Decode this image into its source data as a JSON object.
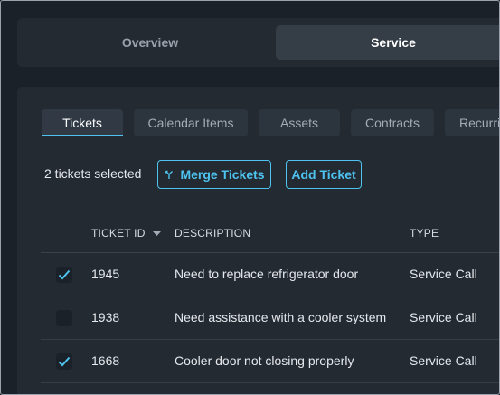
{
  "top_tabs": [
    {
      "label": "Overview",
      "active": false
    },
    {
      "label": "Service",
      "active": true
    }
  ],
  "sub_tabs": [
    {
      "label": "Tickets",
      "active": true
    },
    {
      "label": "Calendar Items",
      "active": false
    },
    {
      "label": "Assets",
      "active": false
    },
    {
      "label": "Contracts",
      "active": false
    },
    {
      "label": "Recurri",
      "active": false
    }
  ],
  "toolbar": {
    "selection_text": "2 tickets selected",
    "merge_label": "Merge Tickets",
    "merge_icon": "merge-icon",
    "add_label": "Add Ticket"
  },
  "table": {
    "columns": [
      "TICKET ID",
      "DESCRIPTION",
      "TYPE"
    ],
    "sort_icon": "sort-down-icon",
    "rows": [
      {
        "selected": true,
        "id": "1945",
        "description": "Need to replace refrigerator door",
        "type": "Service Call"
      },
      {
        "selected": false,
        "id": "1938",
        "description": "Need assistance with a cooler system",
        "type": "Service Call"
      },
      {
        "selected": true,
        "id": "1668",
        "description": "Cooler door not closing properly",
        "type": "Service Call"
      }
    ]
  },
  "colors": {
    "accent": "#4ec3ef",
    "background": "#1b2128",
    "panel": "#232a32"
  }
}
